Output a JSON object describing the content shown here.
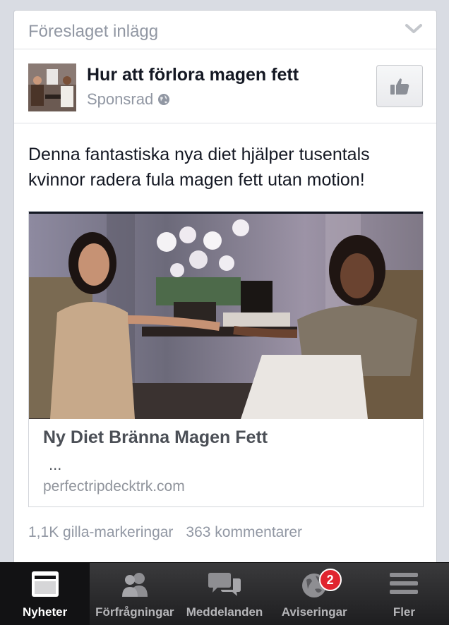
{
  "header": {
    "label": "Föreslaget inlägg",
    "chevron_icon": "chevron-down-icon"
  },
  "post": {
    "page_name": "Hur att förlora magen fett",
    "sponsored_label": "Sponsrad",
    "body": "Denna fantastiska nya diet hjälper tusentals kvinnor radera fula magen fett utan motion!",
    "like_icon": "thumbs-up-icon"
  },
  "link": {
    "title": "Ny Diet Bränna Magen Fett",
    "description": "...",
    "domain": "perfectripdecktrk.com"
  },
  "stats": {
    "likes": "1,1K gilla-markeringar",
    "comments": "363 kommentarer"
  },
  "tabbar": {
    "tabs": [
      {
        "label": "Nyheter",
        "icon": "news-feed-icon",
        "active": true
      },
      {
        "label": "Förfrågningar",
        "icon": "friend-requests-icon"
      },
      {
        "label": "Meddelanden",
        "icon": "messages-icon"
      },
      {
        "label": "Aviseringar",
        "icon": "globe-notifications-icon",
        "badge": "2"
      },
      {
        "label": "Fler",
        "icon": "menu-icon"
      }
    ]
  },
  "colors": {
    "badge": "#e0242f",
    "tabbar": "#2b2b2d",
    "text": "#141823",
    "muted": "#9197a3"
  }
}
